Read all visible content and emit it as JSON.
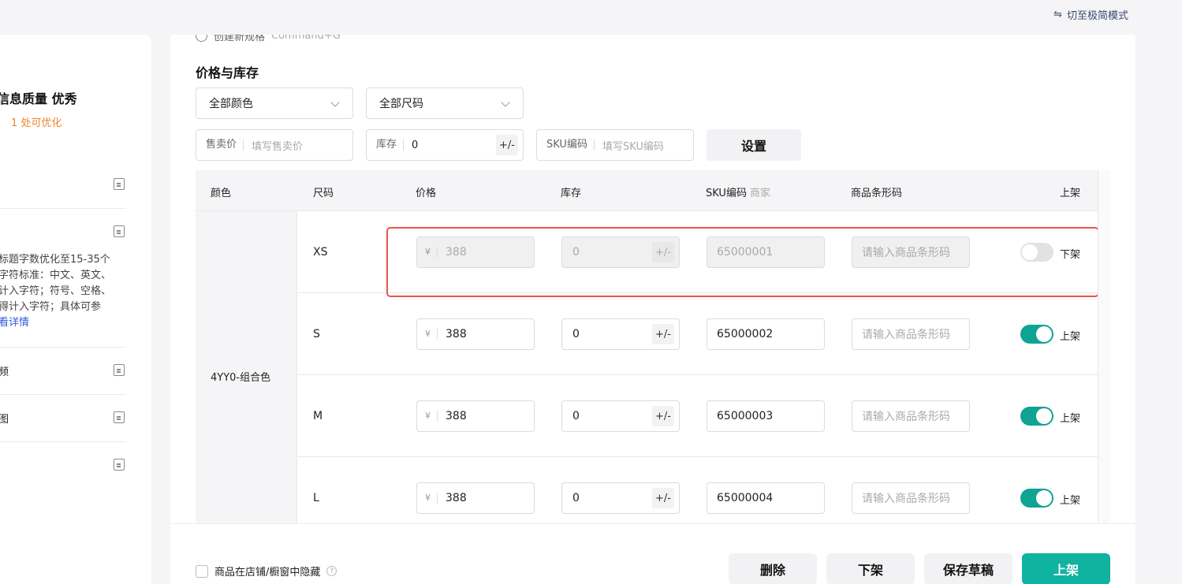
{
  "top": {
    "mode_switch_icon": "swap-icon",
    "mode_switch": "切至极简模式"
  },
  "left_panel": {
    "quality_title": "信息质量 优秀",
    "optimize_hint": "1 处可优化",
    "desc_lines": [
      "标题字数优化至15-35个",
      "字符标准：中文、英文、",
      "计入字符；符号、空格、",
      "得计入字符；具体可参"
    ],
    "view_detail": "看详情",
    "row_labels": [
      "频",
      "图"
    ]
  },
  "main": {
    "create_spec": "创建新规格",
    "create_spec_shortcut": "Command+G",
    "section_title": "价格与库存",
    "color_select": "全部颜色",
    "size_select": "全部尺码",
    "price_field": {
      "label": "售卖价",
      "placeholder": "填写售卖价"
    },
    "stock_field": {
      "label": "库存",
      "value": "0",
      "pm": "+/-"
    },
    "sku_field": {
      "label": "SKU编码",
      "placeholder": "填写SKU编码"
    },
    "set_button": "设置"
  },
  "table": {
    "headers": {
      "color": "颜色",
      "size": "尺码",
      "price": "价格",
      "stock": "库存",
      "sku": "SKU编码",
      "sku_sub": "商家",
      "barcode": "商品条形码",
      "listed": "上架"
    },
    "color_name": "4YY0-组合色",
    "currency": "¥",
    "pm": "+/-",
    "barcode_placeholder": "请输入商品条形码",
    "rows": [
      {
        "size": "XS",
        "price": "388",
        "stock": "0",
        "sku": "65000001",
        "status": "下架",
        "on": false
      },
      {
        "size": "S",
        "price": "388",
        "stock": "0",
        "sku": "65000002",
        "status": "上架",
        "on": true
      },
      {
        "size": "M",
        "price": "388",
        "stock": "0",
        "sku": "65000003",
        "status": "上架",
        "on": true
      },
      {
        "size": "L",
        "price": "388",
        "stock": "0",
        "sku": "65000004",
        "status": "上架",
        "on": true
      }
    ]
  },
  "footer": {
    "hide_label": "商品在店铺/橱窗中隐藏",
    "help": "?",
    "delete": "删除",
    "delist": "下架",
    "save_draft": "保存草稿",
    "list": "上架"
  },
  "colors": {
    "accent": "#10b2a0",
    "toggle_on": "#0fa393",
    "warning": "#f0842c",
    "highlight": "#e8564b",
    "link": "#2b5cd8"
  }
}
